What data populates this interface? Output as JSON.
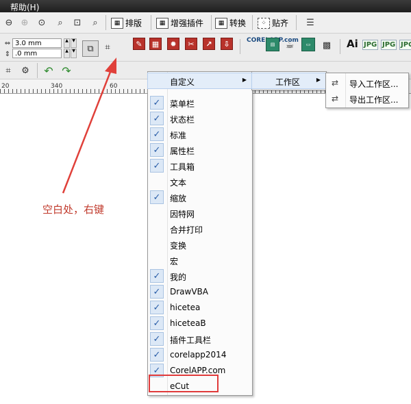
{
  "menubar": {
    "help_label": "帮助(H)"
  },
  "toolbar1": {
    "buttons": [
      {
        "label": "排版",
        "icon": "layout-icon"
      },
      {
        "label": "增强插件",
        "icon": "plugin-icon"
      },
      {
        "label": "转换",
        "icon": "convert-icon"
      },
      {
        "label": "贴齐",
        "icon": "snap-icon"
      }
    ]
  },
  "toolbar2": {
    "width_value": "3.0 mm",
    "height_value": ".0 mm",
    "corel_app_label": "CORELAPP.com",
    "jpg_labels": [
      "JPG",
      "JPG",
      "JPG"
    ],
    "ai_label": "Ai"
  },
  "ruler": {
    "labels": [
      "20",
      "340",
      "60"
    ]
  },
  "annotation": {
    "text": "空白处，右键"
  },
  "context_menu": {
    "items": [
      {
        "label": "自定义",
        "checked": false,
        "submenu": true,
        "highlighted": true
      },
      {
        "label": "菜单栏",
        "checked": true
      },
      {
        "label": "状态栏",
        "checked": true
      },
      {
        "label": "标准",
        "checked": true
      },
      {
        "label": "属性栏",
        "checked": true
      },
      {
        "label": "工具箱",
        "checked": true
      },
      {
        "label": "文本",
        "checked": false
      },
      {
        "label": "缩放",
        "checked": true
      },
      {
        "label": "因特网",
        "checked": false
      },
      {
        "label": "合并打印",
        "checked": false
      },
      {
        "label": "变换",
        "checked": false
      },
      {
        "label": "宏",
        "checked": false
      },
      {
        "label": "我的",
        "checked": true
      },
      {
        "label": "DrawVBA",
        "checked": true
      },
      {
        "label": "hicetea",
        "checked": true
      },
      {
        "label": "hiceteaB",
        "checked": true
      },
      {
        "label": "插件工具栏",
        "checked": true
      },
      {
        "label": "corelapp2014",
        "checked": true
      },
      {
        "label": "CorelAPP.com",
        "checked": true
      },
      {
        "label": "eCut",
        "checked": false
      }
    ]
  },
  "submenu1": {
    "items": [
      {
        "label": "工作区",
        "submenu": true,
        "highlighted": true
      }
    ]
  },
  "submenu2": {
    "items": [
      {
        "label": "导入工作区...",
        "icon": "import-workspace-icon"
      },
      {
        "label": "导出工作区...",
        "icon": "export-workspace-icon"
      }
    ]
  },
  "colors": {
    "highlight_box": "#e03a3a",
    "annotation": "#c0392b",
    "arrow": "#e0403a"
  }
}
